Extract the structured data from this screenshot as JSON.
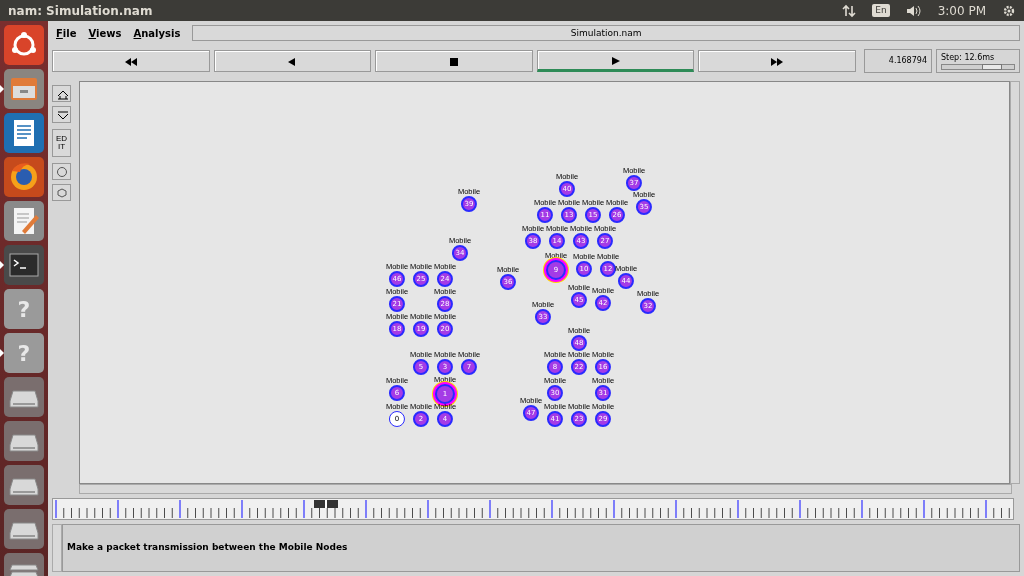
{
  "top_bar": {
    "title": "nam: Simulation.nam",
    "keyboard": "En",
    "time": "3:00 PM"
  },
  "launcher": [
    {
      "kind": "ubuntu",
      "running": false
    },
    {
      "kind": "files",
      "running": true
    },
    {
      "kind": "writer",
      "running": false
    },
    {
      "kind": "browser",
      "running": false
    },
    {
      "kind": "editor",
      "running": false
    },
    {
      "kind": "terminal",
      "running": true
    },
    {
      "kind": "unknown",
      "glyph": "?",
      "running": false
    },
    {
      "kind": "unknown",
      "glyph": "?",
      "running": true
    },
    {
      "kind": "drive",
      "running": false
    },
    {
      "kind": "drive",
      "running": false
    },
    {
      "kind": "drive",
      "running": false
    },
    {
      "kind": "drive",
      "running": false
    },
    {
      "kind": "stack",
      "running": false
    }
  ],
  "menu": [
    "File",
    "Views",
    "Analysis"
  ],
  "file_name": "Simulation.nam",
  "playback": [
    {
      "kind": "rewind",
      "selected": false
    },
    {
      "kind": "back",
      "selected": false
    },
    {
      "kind": "stop",
      "selected": false
    },
    {
      "kind": "play",
      "selected": true
    },
    {
      "kind": "forward",
      "selected": false
    }
  ],
  "time": "4.168794",
  "step": {
    "label": "Step: 12.6ms",
    "level": 0.7
  },
  "tools": [
    {
      "kind": "zoom-in"
    },
    {
      "kind": "zoom-out"
    },
    {
      "kind": "edit",
      "text": "EDIT"
    },
    {
      "kind": "node"
    },
    {
      "kind": "agent"
    }
  ],
  "nodes": [
    {
      "label": "Mobile",
      "number": "39",
      "highlighted": false,
      "filled": true
    },
    {
      "label": "Mobile",
      "number": "34",
      "highlighted": false,
      "filled": true
    },
    {
      "label": "Mobile",
      "number": "46",
      "highlighted": false,
      "filled": true
    },
    {
      "label": "Mobile",
      "number": "25",
      "highlighted": false,
      "filled": true
    },
    {
      "label": "Mobile",
      "number": "24",
      "highlighted": false,
      "filled": true
    },
    {
      "label": "Mobile",
      "number": "36",
      "highlighted": false,
      "filled": true
    },
    {
      "label": "Mobile",
      "number": "21",
      "highlighted": false,
      "filled": true
    },
    {
      "label": "Mobile",
      "number": "28",
      "highlighted": false,
      "filled": true
    },
    {
      "label": "Mobile",
      "number": "18",
      "highlighted": false,
      "filled": true
    },
    {
      "label": "Mobile",
      "number": "19",
      "highlighted": false,
      "filled": true
    },
    {
      "label": "Mobile",
      "number": "20",
      "highlighted": false,
      "filled": true
    },
    {
      "label": "Mobile",
      "number": "5",
      "highlighted": false,
      "filled": true
    },
    {
      "label": "Mobile",
      "number": "3",
      "highlighted": false,
      "filled": true
    },
    {
      "label": "Mobile",
      "number": "7",
      "highlighted": false,
      "filled": true
    },
    {
      "label": "Mobile",
      "number": "6",
      "highlighted": false,
      "filled": true
    },
    {
      "label": "Mobile",
      "number": "1",
      "highlighted": true,
      "filled": true
    },
    {
      "label": "Mobile",
      "number": "0",
      "highlighted": false,
      "filled": false
    },
    {
      "label": "Mobile",
      "number": "2",
      "highlighted": false,
      "filled": true
    },
    {
      "label": "Mobile",
      "number": "4",
      "highlighted": false,
      "filled": true
    },
    {
      "label": "Mobile",
      "number": "37",
      "highlighted": false,
      "filled": true
    },
    {
      "label": "Mobile",
      "number": "40",
      "highlighted": false,
      "filled": true
    },
    {
      "label": "Mobile",
      "number": "35",
      "highlighted": false,
      "filled": true
    },
    {
      "label": "Mobile",
      "number": "11",
      "highlighted": false,
      "filled": true
    },
    {
      "label": "Mobile",
      "number": "13",
      "highlighted": false,
      "filled": true
    },
    {
      "label": "Mobile",
      "number": "15",
      "highlighted": false,
      "filled": true
    },
    {
      "label": "Mobile",
      "number": "26",
      "highlighted": false,
      "filled": true
    },
    {
      "label": "Mobile",
      "number": "38",
      "highlighted": false,
      "filled": true
    },
    {
      "label": "Mobile",
      "number": "14",
      "highlighted": false,
      "filled": true
    },
    {
      "label": "Mobile",
      "number": "43",
      "highlighted": false,
      "filled": true
    },
    {
      "label": "Mobile",
      "number": "27",
      "highlighted": false,
      "filled": true
    },
    {
      "label": "Mobile",
      "number": "9",
      "highlighted": true,
      "filled": true
    },
    {
      "label": "Mobile",
      "number": "10",
      "highlighted": false,
      "filled": true
    },
    {
      "label": "Mobile",
      "number": "12",
      "highlighted": false,
      "filled": true
    },
    {
      "label": "Mobile",
      "number": "44",
      "highlighted": false,
      "filled": true
    },
    {
      "label": "Mobile",
      "number": "45",
      "highlighted": false,
      "filled": true
    },
    {
      "label": "Mobile",
      "number": "42",
      "highlighted": false,
      "filled": true
    },
    {
      "label": "Mobile",
      "number": "32",
      "highlighted": false,
      "filled": true
    },
    {
      "label": "Mobile",
      "number": "33",
      "highlighted": false,
      "filled": true
    },
    {
      "label": "Mobile",
      "number": "48",
      "highlighted": false,
      "filled": true
    },
    {
      "label": "Mobile",
      "number": "8",
      "highlighted": false,
      "filled": true
    },
    {
      "label": "Mobile",
      "number": "22",
      "highlighted": false,
      "filled": true
    },
    {
      "label": "Mobile",
      "number": "16",
      "highlighted": false,
      "filled": true
    },
    {
      "label": "Mobile",
      "number": "30",
      "highlighted": false,
      "filled": true
    },
    {
      "label": "Mobile",
      "number": "31",
      "highlighted": false,
      "filled": true
    },
    {
      "label": "Mobile",
      "number": "47",
      "highlighted": false,
      "filled": true
    },
    {
      "label": "Mobile",
      "number": "41",
      "highlighted": false,
      "filled": true
    },
    {
      "label": "Mobile",
      "number": "23",
      "highlighted": false,
      "filled": true
    },
    {
      "label": "Mobile",
      "number": "29",
      "highlighted": false,
      "filled": true
    }
  ],
  "message": "Make a packet transmission between the Mobile Nodes"
}
